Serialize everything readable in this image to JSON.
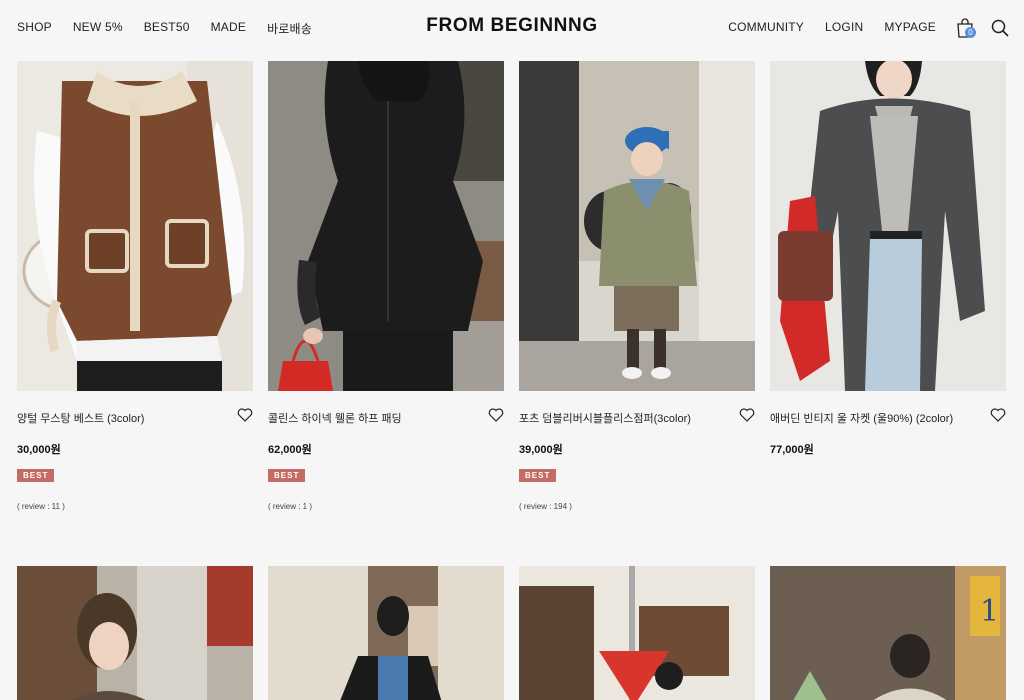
{
  "header": {
    "nav_left": [
      "SHOP",
      "NEW 5%",
      "BEST50",
      "MADE",
      "바로배송"
    ],
    "logo": "FROM BEGINNNG",
    "nav_right": [
      "COMMUNITY",
      "LOGIN",
      "MYPAGE"
    ],
    "cart_count": "0"
  },
  "products": [
    {
      "name": "양털 무스탕 베스트 (3color)",
      "price": "30,000원",
      "badge": "BEST",
      "review": "( review : 11 )"
    },
    {
      "name": "콜린스 하이넥 웰론 하프 패딩",
      "price": "62,000원",
      "badge": "BEST",
      "review": "( review : 1 )"
    },
    {
      "name": "포츠 덤블리버시블플리스점퍼(3color)",
      "price": "39,000원",
      "badge": "BEST",
      "review": "( review : 194 )"
    },
    {
      "name": "애버딘 빈티지 울 자켓 (울90%) (2color)",
      "price": "77,000원",
      "badge": "",
      "review": ""
    }
  ],
  "colors": {
    "background": "#f6f6f6",
    "badge": "#c46b63",
    "cart_badge": "#5a8fd8"
  },
  "icons": [
    "cart-icon",
    "search-icon",
    "heart-icon"
  ]
}
